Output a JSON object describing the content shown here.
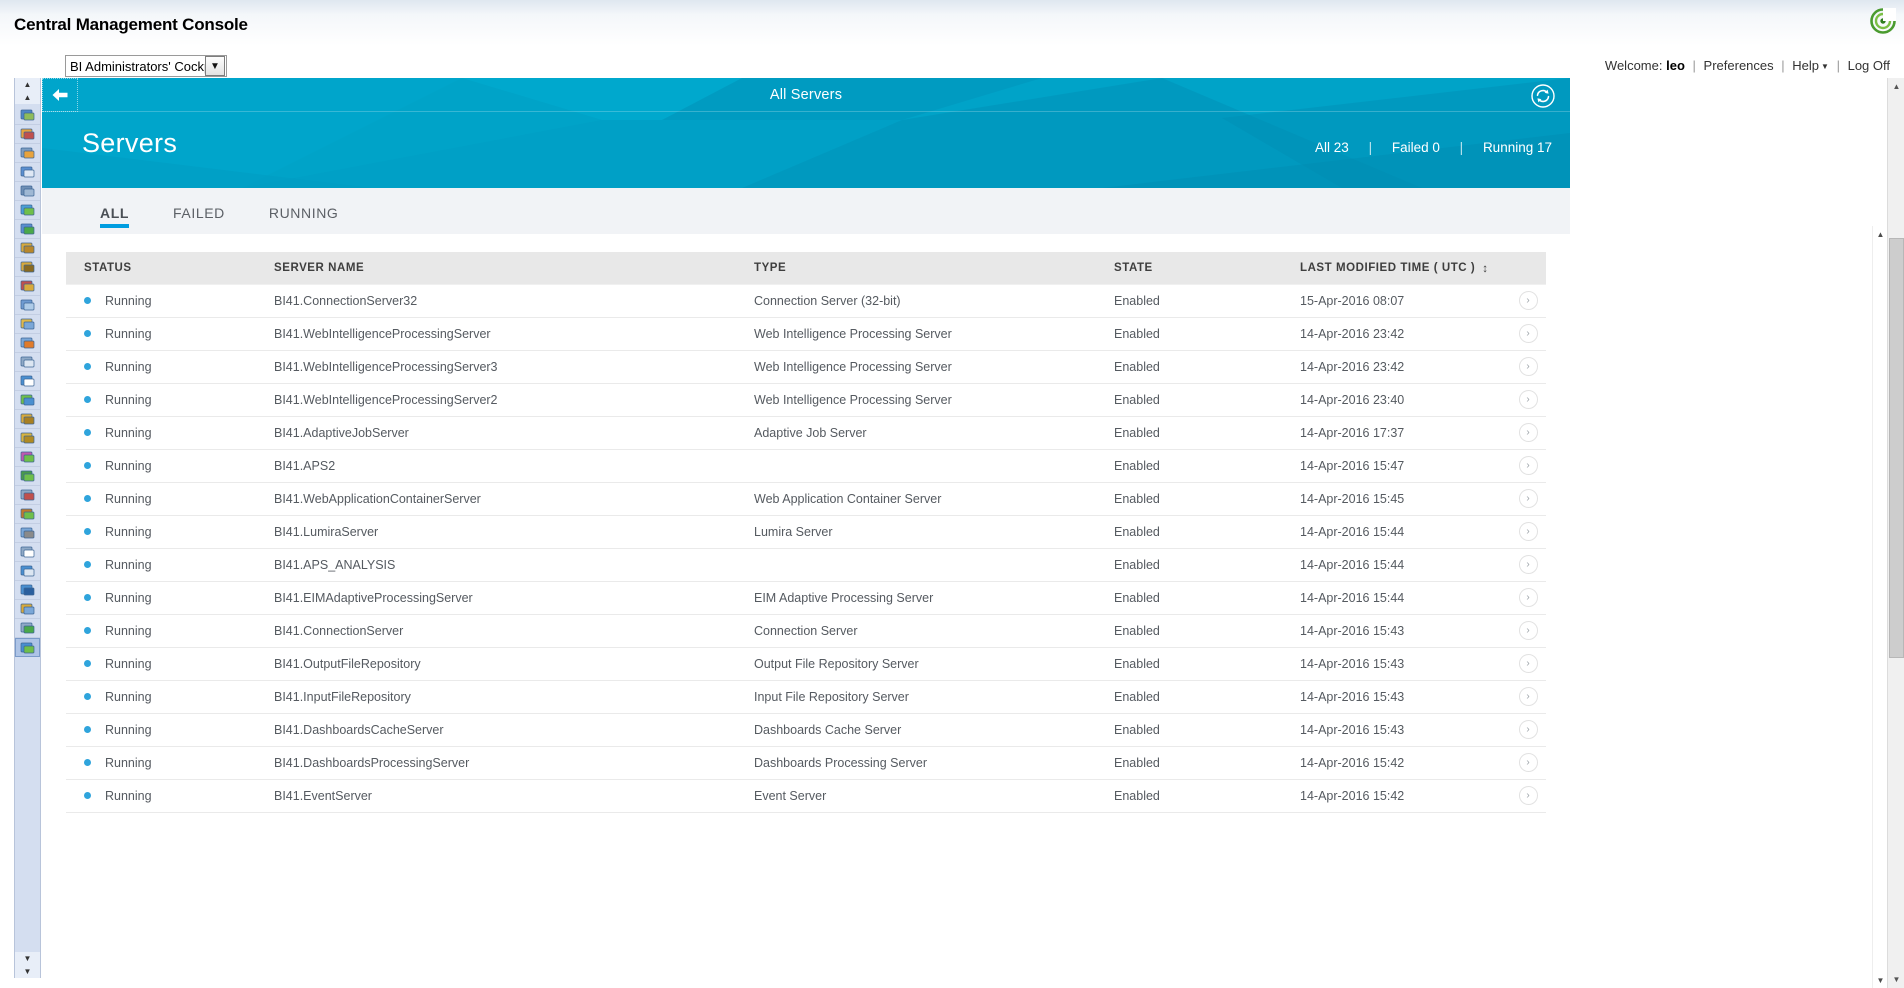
{
  "app": {
    "title": "Central Management Console",
    "cockpit_selector": "BI Administrators' Cockpit"
  },
  "user_bar": {
    "welcome_label": "Welcome:",
    "username": "leo",
    "preferences": "Preferences",
    "help": "Help",
    "log_off": "Log Off",
    "sep": "|"
  },
  "banner": {
    "breadcrumb_title": "All Servers",
    "heading": "Servers",
    "back_icon": "back-arrow-icon",
    "refresh_icon": "refresh-icon",
    "counts": [
      {
        "label": "All 23"
      },
      {
        "label": "Failed 0"
      },
      {
        "label": "Running 17"
      }
    ],
    "count_separator": "|"
  },
  "tabs": [
    {
      "label": "ALL",
      "active": true
    },
    {
      "label": "FAILED",
      "active": false
    },
    {
      "label": "RUNNING",
      "active": false
    }
  ],
  "table": {
    "columns": [
      {
        "key": "status",
        "label": "STATUS",
        "sortable": false
      },
      {
        "key": "name",
        "label": "SERVER NAME",
        "sortable": false
      },
      {
        "key": "type",
        "label": "TYPE",
        "sortable": false
      },
      {
        "key": "state",
        "label": "STATE",
        "sortable": false
      },
      {
        "key": "time",
        "label": "LAST MODIFIED TIME ( UTC )",
        "sortable": true
      }
    ],
    "sort_indicator": "↕",
    "row_arrow": "›",
    "rows": [
      {
        "status": "Running",
        "name": "BI41.ConnectionServer32",
        "type": "Connection Server (32-bit)",
        "state": "Enabled",
        "time": "15-Apr-2016 08:07"
      },
      {
        "status": "Running",
        "name": "BI41.WebIntelligenceProcessingServer",
        "type": "Web Intelligence Processing Server",
        "state": "Enabled",
        "time": "14-Apr-2016 23:42"
      },
      {
        "status": "Running",
        "name": "BI41.WebIntelligenceProcessingServer3",
        "type": "Web Intelligence Processing Server",
        "state": "Enabled",
        "time": "14-Apr-2016 23:42"
      },
      {
        "status": "Running",
        "name": "BI41.WebIntelligenceProcessingServer2",
        "type": "Web Intelligence Processing Server",
        "state": "Enabled",
        "time": "14-Apr-2016 23:40"
      },
      {
        "status": "Running",
        "name": "BI41.AdaptiveJobServer",
        "type": "Adaptive Job Server",
        "state": "Enabled",
        "time": "14-Apr-2016 17:37"
      },
      {
        "status": "Running",
        "name": "BI41.APS2",
        "type": "",
        "state": "Enabled",
        "time": "14-Apr-2016 15:47"
      },
      {
        "status": "Running",
        "name": "BI41.WebApplicationContainerServer",
        "type": "Web Application Container Server",
        "state": "Enabled",
        "time": "14-Apr-2016 15:45"
      },
      {
        "status": "Running",
        "name": "BI41.LumiraServer",
        "type": "Lumira Server",
        "state": "Enabled",
        "time": "14-Apr-2016 15:44"
      },
      {
        "status": "Running",
        "name": "BI41.APS_ANALYSIS",
        "type": "",
        "state": "Enabled",
        "time": "14-Apr-2016 15:44"
      },
      {
        "status": "Running",
        "name": "BI41.EIMAdaptiveProcessingServer",
        "type": "EIM Adaptive Processing Server",
        "state": "Enabled",
        "time": "14-Apr-2016 15:44"
      },
      {
        "status": "Running",
        "name": "BI41.ConnectionServer",
        "type": "Connection Server",
        "state": "Enabled",
        "time": "14-Apr-2016 15:43"
      },
      {
        "status": "Running",
        "name": "BI41.OutputFileRepository",
        "type": "Output File Repository Server",
        "state": "Enabled",
        "time": "14-Apr-2016 15:43"
      },
      {
        "status": "Running",
        "name": "BI41.InputFileRepository",
        "type": "Input File Repository Server",
        "state": "Enabled",
        "time": "14-Apr-2016 15:43"
      },
      {
        "status": "Running",
        "name": "BI41.DashboardsCacheServer",
        "type": "Dashboards Cache Server",
        "state": "Enabled",
        "time": "14-Apr-2016 15:43"
      },
      {
        "status": "Running",
        "name": "BI41.DashboardsProcessingServer",
        "type": "Dashboards Processing Server",
        "state": "Enabled",
        "time": "14-Apr-2016 15:42"
      },
      {
        "status": "Running",
        "name": "BI41.EventServer",
        "type": "Event Server",
        "state": "Enabled",
        "time": "14-Apr-2016 15:42"
      }
    ]
  },
  "rail": {
    "scroll_up_top": "▲",
    "scroll_up": "▲",
    "scroll_down": "▼",
    "scroll_down_bottom": "▼",
    "icons": [
      "folders-icon",
      "users-icon",
      "user-group-icon",
      "inbox-icon",
      "database-icon",
      "universe-icon",
      "connections-icon",
      "gold-cylinder-icon",
      "folder-key-icon",
      "user-settings-icon",
      "grid-icon",
      "calendar-grid-icon",
      "events-alert-icon",
      "list-icon",
      "info-icon",
      "license-icon",
      "lock-icon",
      "key-icon",
      "promotion-icon",
      "green-bars-icon",
      "query-icon",
      "package-icon",
      "settings-doc-icon",
      "clipboard-icon",
      "monitor-icon",
      "audit-icon",
      "sessions-icon",
      "copy-check-icon",
      "servers-icon"
    ],
    "selected_index": 28
  },
  "colors": {
    "banner": "#00a0c6",
    "accent": "#009de0",
    "status_dot": "#2fa4dc",
    "header_bg": "#e8e8e8"
  }
}
